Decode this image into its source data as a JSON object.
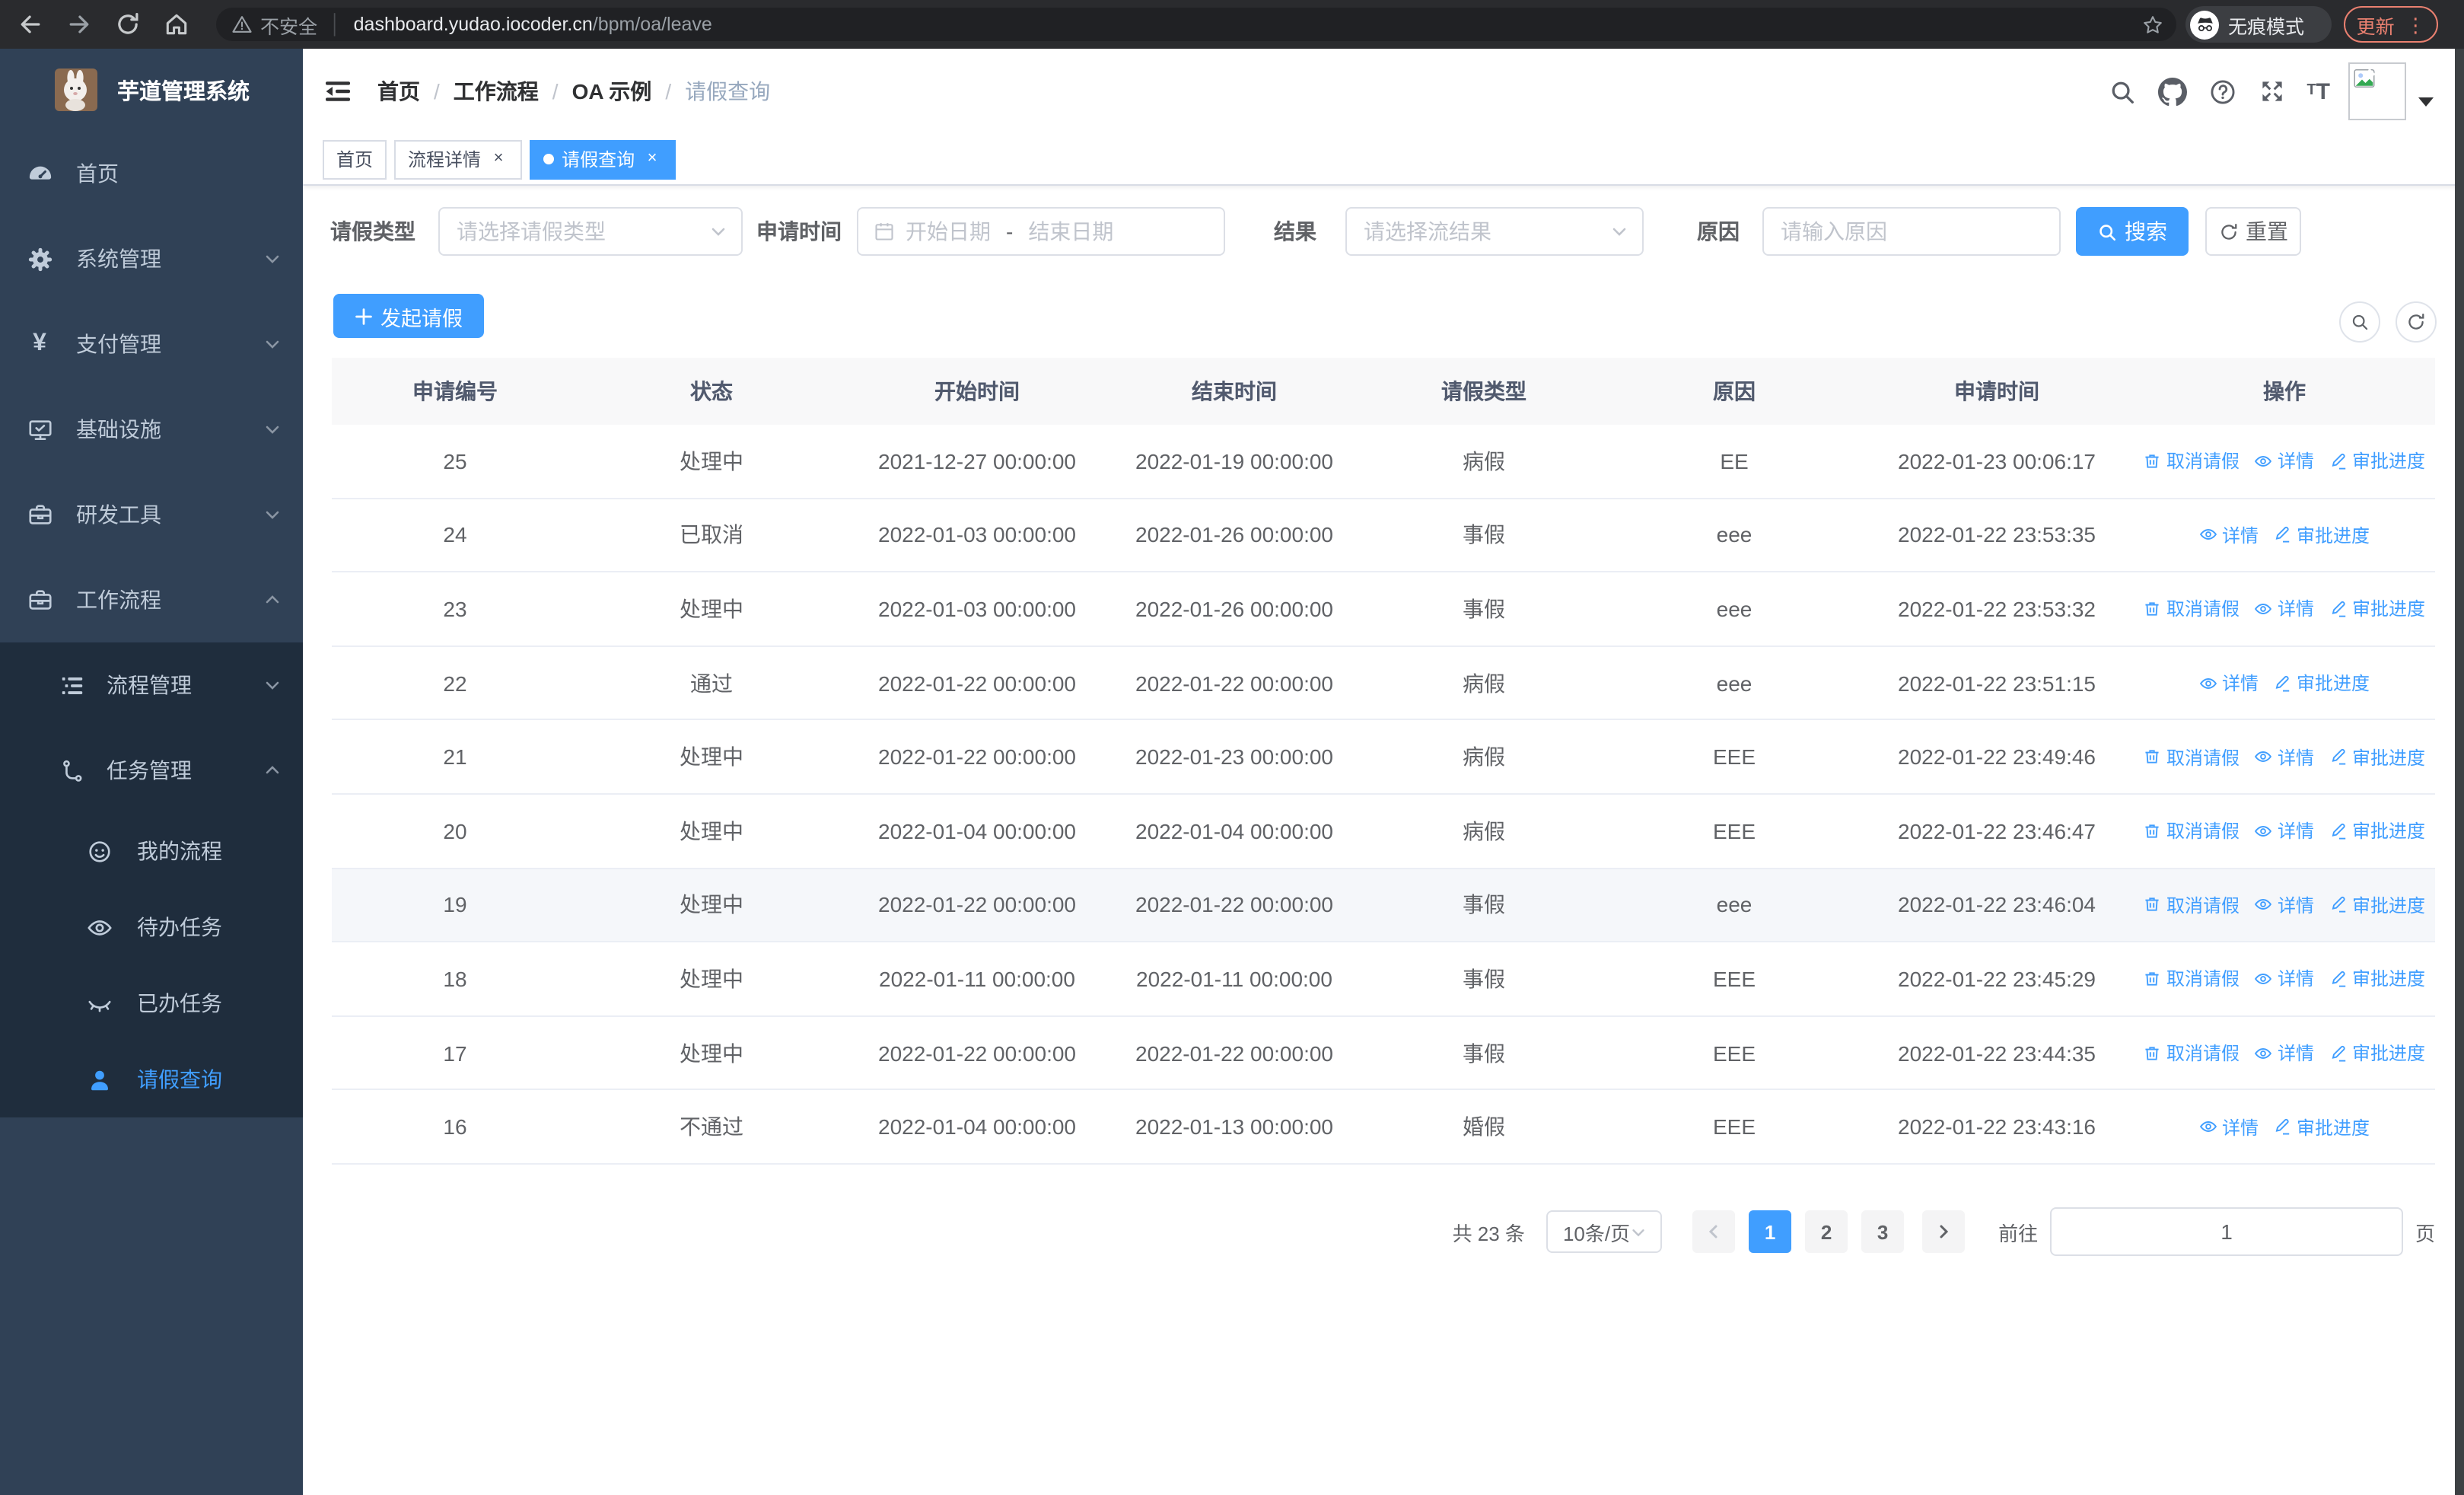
{
  "browser": {
    "insecure_label": "不安全",
    "url_host": "dashboard.yudao.iocoder.cn",
    "url_path": "/bpm/oa/leave",
    "incognito_label": "无痕模式",
    "update_label": "更新",
    "menu_dots": "⋮"
  },
  "sidebar": {
    "title": "芋道管理系统",
    "items": [
      {
        "label": "首页",
        "icon": "gauge-icon"
      },
      {
        "label": "系统管理",
        "icon": "gear-icon",
        "chevron": "down"
      },
      {
        "label": "支付管理",
        "icon": "yen-icon",
        "glyph": "¥",
        "chevron": "down"
      },
      {
        "label": "基础设施",
        "icon": "monitor-icon",
        "chevron": "down"
      },
      {
        "label": "研发工具",
        "icon": "toolbox-icon",
        "chevron": "down"
      },
      {
        "label": "工作流程",
        "icon": "toolbox-icon",
        "chevron": "up"
      },
      {
        "label": "流程管理",
        "icon": "list-icon",
        "chevron": "down"
      },
      {
        "label": "任务管理",
        "icon": "flow-icon",
        "chevron": "up"
      },
      {
        "label": "我的流程",
        "icon": "face-icon"
      },
      {
        "label": "待办任务",
        "icon": "eye-icon"
      },
      {
        "label": "已办任务",
        "icon": "eye-closed-icon"
      },
      {
        "label": "请假查询",
        "icon": "user-icon",
        "active": true
      }
    ]
  },
  "header": {
    "breadcrumb": [
      "首页",
      "工作流程",
      "OA 示例",
      "请假查询"
    ],
    "separator": "/",
    "tabs": [
      {
        "label": "首页",
        "closable": false,
        "active": false
      },
      {
        "label": "流程详情",
        "closable": true,
        "active": false
      },
      {
        "label": "请假查询",
        "closable": true,
        "active": true
      }
    ],
    "close_glyph": "×"
  },
  "filters": {
    "leave_type_label": "请假类型",
    "leave_type_placeholder": "请选择请假类型",
    "apply_time_label": "申请时间",
    "date_start_placeholder": "开始日期",
    "date_separator": "-",
    "date_end_placeholder": "结束日期",
    "result_label": "结果",
    "result_placeholder": "请选择流结果",
    "reason_label": "原因",
    "reason_placeholder": "请输入原因",
    "search_label": "搜索",
    "reset_label": "重置"
  },
  "toolbar": {
    "create_label": "发起请假"
  },
  "table": {
    "columns": [
      "申请编号",
      "状态",
      "开始时间",
      "结束时间",
      "请假类型",
      "原因",
      "申请时间",
      "操作"
    ],
    "action_labels": {
      "cancel": "取消请假",
      "detail": "详情",
      "progress": "审批进度"
    },
    "rows": [
      {
        "id": "25",
        "status": "处理中",
        "start": "2021-12-27 00:00:00",
        "end": "2022-01-19 00:00:00",
        "type": "病假",
        "reason": "EE",
        "apply": "2022-01-23 00:06:17",
        "can_cancel": true,
        "highlight": false
      },
      {
        "id": "24",
        "status": "已取消",
        "start": "2022-01-03 00:00:00",
        "end": "2022-01-26 00:00:00",
        "type": "事假",
        "reason": "eee",
        "apply": "2022-01-22 23:53:35",
        "can_cancel": false,
        "highlight": false
      },
      {
        "id": "23",
        "status": "处理中",
        "start": "2022-01-03 00:00:00",
        "end": "2022-01-26 00:00:00",
        "type": "事假",
        "reason": "eee",
        "apply": "2022-01-22 23:53:32",
        "can_cancel": true,
        "highlight": false
      },
      {
        "id": "22",
        "status": "通过",
        "start": "2022-01-22 00:00:00",
        "end": "2022-01-22 00:00:00",
        "type": "病假",
        "reason": "eee",
        "apply": "2022-01-22 23:51:15",
        "can_cancel": false,
        "highlight": false
      },
      {
        "id": "21",
        "status": "处理中",
        "start": "2022-01-22 00:00:00",
        "end": "2022-01-23 00:00:00",
        "type": "病假",
        "reason": "EEE",
        "apply": "2022-01-22 23:49:46",
        "can_cancel": true,
        "highlight": false
      },
      {
        "id": "20",
        "status": "处理中",
        "start": "2022-01-04 00:00:00",
        "end": "2022-01-04 00:00:00",
        "type": "病假",
        "reason": "EEE",
        "apply": "2022-01-22 23:46:47",
        "can_cancel": true,
        "highlight": false
      },
      {
        "id": "19",
        "status": "处理中",
        "start": "2022-01-22 00:00:00",
        "end": "2022-01-22 00:00:00",
        "type": "事假",
        "reason": "eee",
        "apply": "2022-01-22 23:46:04",
        "can_cancel": true,
        "highlight": true
      },
      {
        "id": "18",
        "status": "处理中",
        "start": "2022-01-11 00:00:00",
        "end": "2022-01-11 00:00:00",
        "type": "事假",
        "reason": "EEE",
        "apply": "2022-01-22 23:45:29",
        "can_cancel": true,
        "highlight": false
      },
      {
        "id": "17",
        "status": "处理中",
        "start": "2022-01-22 00:00:00",
        "end": "2022-01-22 00:00:00",
        "type": "事假",
        "reason": "EEE",
        "apply": "2022-01-22 23:44:35",
        "can_cancel": true,
        "highlight": false
      },
      {
        "id": "16",
        "status": "不通过",
        "start": "2022-01-04 00:00:00",
        "end": "2022-01-13 00:00:00",
        "type": "婚假",
        "reason": "EEE",
        "apply": "2022-01-22 23:43:16",
        "can_cancel": false,
        "highlight": false
      }
    ]
  },
  "pagination": {
    "total_label": "共 23 条",
    "page_size_label": "10条/页",
    "pages": [
      "1",
      "2",
      "3"
    ],
    "active_page": "1",
    "goto_label": "前往",
    "goto_value": "1",
    "page_unit_label": "页"
  },
  "colors": {
    "accent": "#409eff",
    "sidebar_bg": "#304156",
    "sidebar_submenu_bg": "#1f2d3d",
    "update_chip": "#ea8070",
    "table_header_bg": "#f8f8f9"
  }
}
